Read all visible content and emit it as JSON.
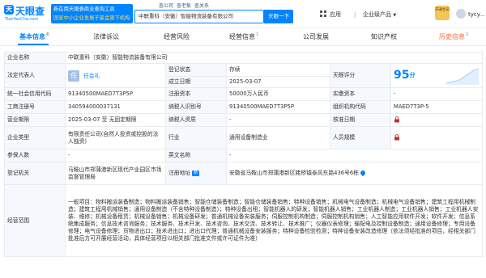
{
  "header": {
    "logo_text": "天眼查",
    "logo_domain": "TianYanCha.com",
    "promo_line1": "新在用天眼查商业查询工具",
    "promo_line2": "国家中小企业发展子基金旗下机构",
    "search_tabs": [
      "查公司",
      "查老板",
      "查关系"
    ],
    "search_value": "中联重科（安徽）智能物流装备有限公司",
    "search_button": "天眼一下",
    "nav_app": "应用",
    "nav_product": "企业级产品",
    "vip_label": "开通会员",
    "user_name": "tycy..."
  },
  "tabs": [
    {
      "label": "基本信息",
      "count": "6",
      "active": true
    },
    {
      "label": "法律诉讼",
      "count": "",
      "active": false
    },
    {
      "label": "经营风险",
      "count": "",
      "active": false
    },
    {
      "label": "经营信息",
      "count": "1",
      "active": false
    },
    {
      "label": "公司发展",
      "count": "",
      "active": false
    },
    {
      "label": "知识产权",
      "count": "",
      "active": false
    },
    {
      "label": "历史信息",
      "count": "2",
      "active": false
    }
  ],
  "info": {
    "company_name_label": "企业名称",
    "company_name": "中联重科（安徽）智能物流装备有限公司",
    "legal_rep_label": "法定代表人",
    "legal_rep_badge": "任",
    "legal_rep": "任会礼",
    "reg_status_label": "登记状态",
    "reg_status": "存续",
    "found_date_label": "成立日期",
    "found_date": "2025-03-07",
    "score_label": "天眼评分",
    "score": "95",
    "score_unit": "分",
    "credit_code_label": "统一社会信用代码",
    "credit_code": "91340500MAED7T3P5P",
    "reg_capital_label": "注册资本",
    "reg_capital": "50000万人民币",
    "paid_capital_label": "实缴资本",
    "paid_capital": "-",
    "biz_reg_no_label": "工商注册号",
    "biz_reg_no": "340594000037131",
    "taxpayer_id_label": "纳税人识别号",
    "taxpayer_id": "91340500MAED7T3P5P",
    "org_code_label": "组织机构代码",
    "org_code": "MAED7T3P-5",
    "term_label": "营业期限",
    "term": "2025-03-07 至 无固定期限",
    "taxpayer_qual_label": "纳税人资质",
    "taxpayer_qual": "-",
    "approve_date_label": "核准日期",
    "company_type_label": "企业类型",
    "company_type": "有限责任公司(自然人投资或控股的法人独资)",
    "industry_label": "行业",
    "industry": "通用设备制造业",
    "staff_size_label": "人员规模",
    "insured_label": "参保人数",
    "insured": "-",
    "english_name_label": "英文名称",
    "english_name": "-",
    "reg_authority_label": "登记机关",
    "reg_authority": "马鞍山市郑蒲港新区现代产业园区市场监督管理局",
    "reg_address_label": "注册地址",
    "reg_address": "安徽省马鞍山市郑蒲港新区姥桥镇泰风东路436号6栋",
    "scope_label": "经营范围",
    "scope": "一般项目：物料搬运装备制造；物料搬运装备销售；智能仓储装备制造；智能仓储装备销售；特种设备销售；机械电气设备制造；机械电气设备销售；建筑工程用机械制造；建筑工程用机械销售；通用设备制造（不含特种设备制造）；特种设备出租；智能机器人的研发；智能机器人销售；工业机器人制造；工业机器人销售；工业机器人安装、维修；机械设备租赁；机械设备销售；机械设备研发；普通机械设备安装服务；伺服控制机构制造；伺服控制机构销售；人工智能应用软件开发；软件开发；信息系统集成服务；信息技术咨询服务；技术服务、技术开发、技术咨询、技术交流、技术转让、技术推广；仪器仪表修理；输配电及控制设备制造；通用设备修理；专用设备修理；电气设备修理；货物进出口；技术进出口；进出口代理；普通机械设备安装服务；特种设备检验检测；特种设备安装改造修理（依法须经批准的项目，经相关部门批准后方可开展经营活动，具体经营项目以相关部门批准文件或许可证件为准）"
  },
  "colors": {
    "brand": "#0084ff",
    "status_ok": "#11a65c",
    "history": "#ff6633",
    "label_bg": "#f5f8fc"
  },
  "icons": [
    "search-icon",
    "grid-icon",
    "map-pin-icon",
    "lock-icon",
    "trend-sparkline"
  ]
}
